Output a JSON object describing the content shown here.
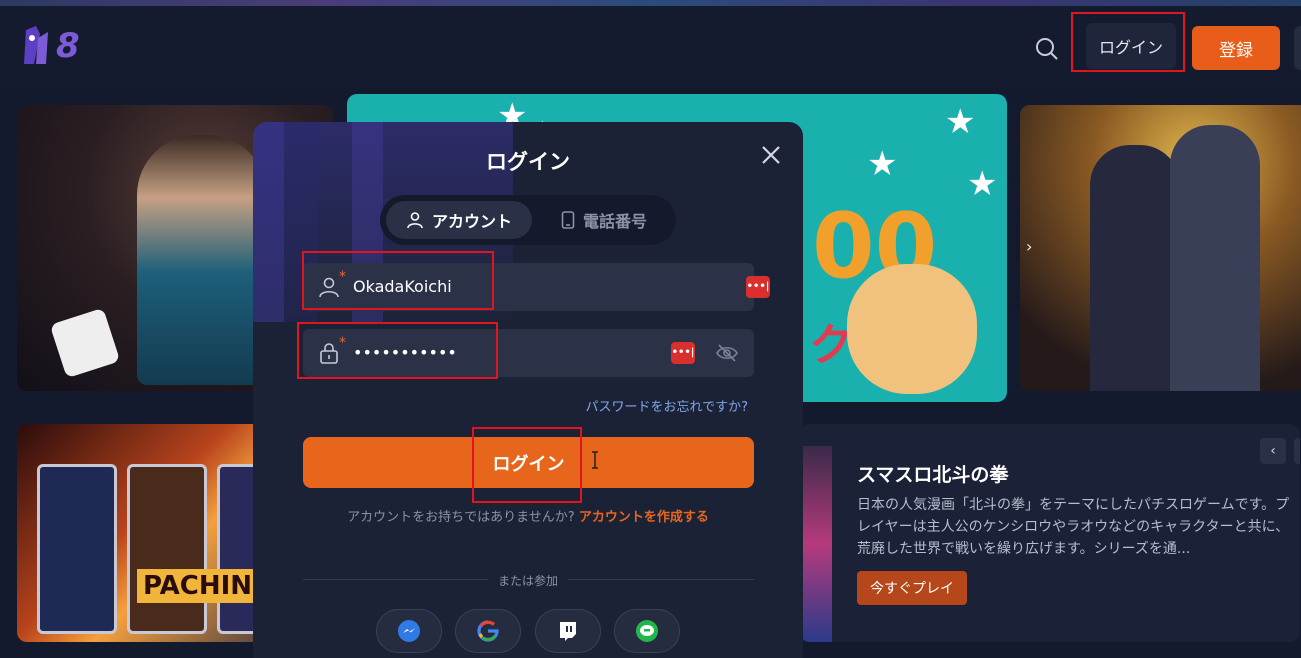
{
  "header": {
    "logo_text": "8",
    "login_label": "ログイン",
    "register_label": "登録"
  },
  "banners": {
    "promo_digits": "00",
    "promo_kana": "ク",
    "pachinko_label": "PACHIN"
  },
  "featured": {
    "title": "スマスロ北斗の拳",
    "description": "日本の人気漫画「北斗の拳」をテーマにしたパチスロゲームです。プレイヤーは主人公のケンシロウやラオウなどのキャラクターと共に、荒廃した世界で戦いを繰り広げます。シリーズを通...",
    "play_label": "今すぐプレイ"
  },
  "modal": {
    "title": "ログイン",
    "tabs": [
      {
        "label": "アカウント",
        "icon": "user-icon",
        "active": true
      },
      {
        "label": "電話番号",
        "icon": "phone-icon",
        "active": false
      }
    ],
    "username": {
      "value": "OkadaKoichi",
      "required_mark": "*"
    },
    "password": {
      "value": "•••••••••••",
      "required_mark": "*"
    },
    "pw_manager_glyph": "•••|",
    "forgot_label": "パスワードをお忘れですか?",
    "submit_label": "ログイン",
    "no_account_text": "アカウントをお持ちではありませんか?",
    "create_account_label": "アカウントを作成する",
    "or_join_label": "または参加",
    "social": [
      "messenger-icon",
      "google-icon",
      "twitch-icon",
      "line-icon"
    ]
  },
  "colors": {
    "accent": "#e8661b",
    "highlight": "#e0161e",
    "background": "#141a2e",
    "modal": "#1c2236"
  }
}
